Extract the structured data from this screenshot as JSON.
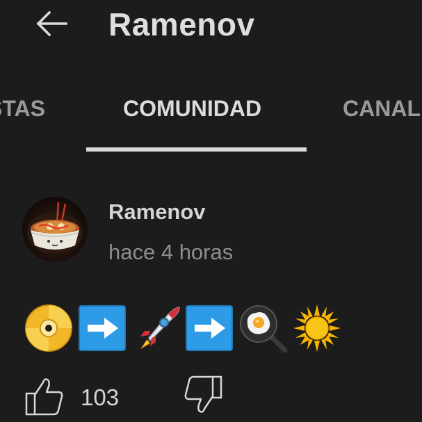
{
  "header": {
    "title": "Ramenov"
  },
  "tabs": [
    {
      "label": "STAS",
      "active": false
    },
    {
      "label": "COMUNIDAD",
      "active": true
    },
    {
      "label": "CANAL",
      "active": false
    }
  ],
  "post": {
    "author": "Ramenov",
    "time": "hace 4 horas",
    "emojis": [
      "dvd-disc-icon",
      "right-arrow-icon",
      "rocket-icon",
      "right-arrow-icon",
      "frying-pan-egg-icon",
      "sun-icon"
    ],
    "likes": "103"
  },
  "colors": {
    "background": "#1c1c1c",
    "text_primary": "#dedede",
    "text_secondary": "#8e8e8e",
    "arrow_box": "#2d9be6"
  }
}
